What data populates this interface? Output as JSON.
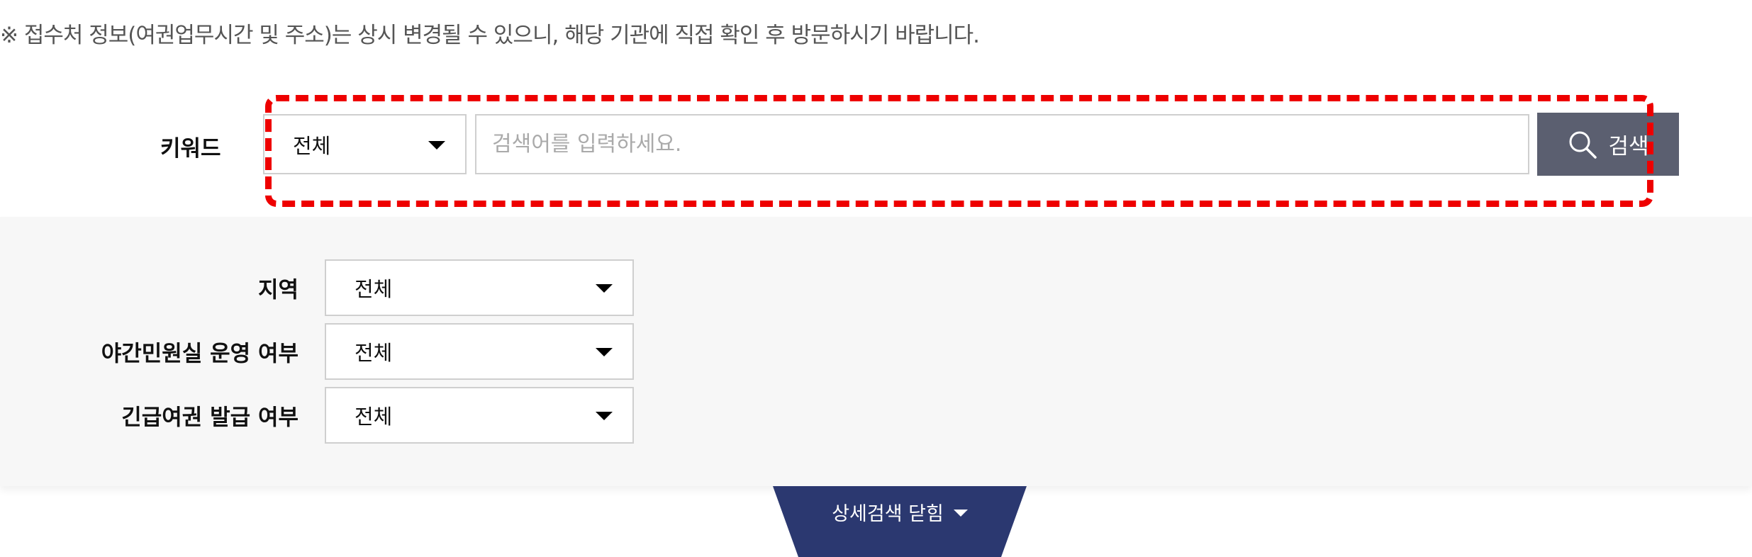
{
  "notice": {
    "text": "※ 접수처 정보(여권업무시간 및 주소)는 상시 변경될 수 있으니, 해당 기관에 직접 확인 후 방문하시기 바랍니다."
  },
  "keyword": {
    "label": "키워드",
    "select_value": "전체",
    "search_placeholder": "검색어를 입력하세요.",
    "search_value": "",
    "search_button_label": "검색"
  },
  "filters": [
    {
      "label": "지역",
      "value": "전체"
    },
    {
      "label": "야간민원실 운영 여부",
      "value": "전체"
    },
    {
      "label": "긴급여권 발급 여부",
      "value": "전체"
    }
  ],
  "detail_toggle": {
    "label": "상세검색 닫힘"
  },
  "colors": {
    "search_button": "#5b5f70",
    "toggle_tab": "#2b3870",
    "highlight": "#ee0000",
    "detail_bg": "#f7f7f7"
  },
  "icons": {
    "search": "search-icon",
    "dropdown": "chevron-down-icon"
  }
}
